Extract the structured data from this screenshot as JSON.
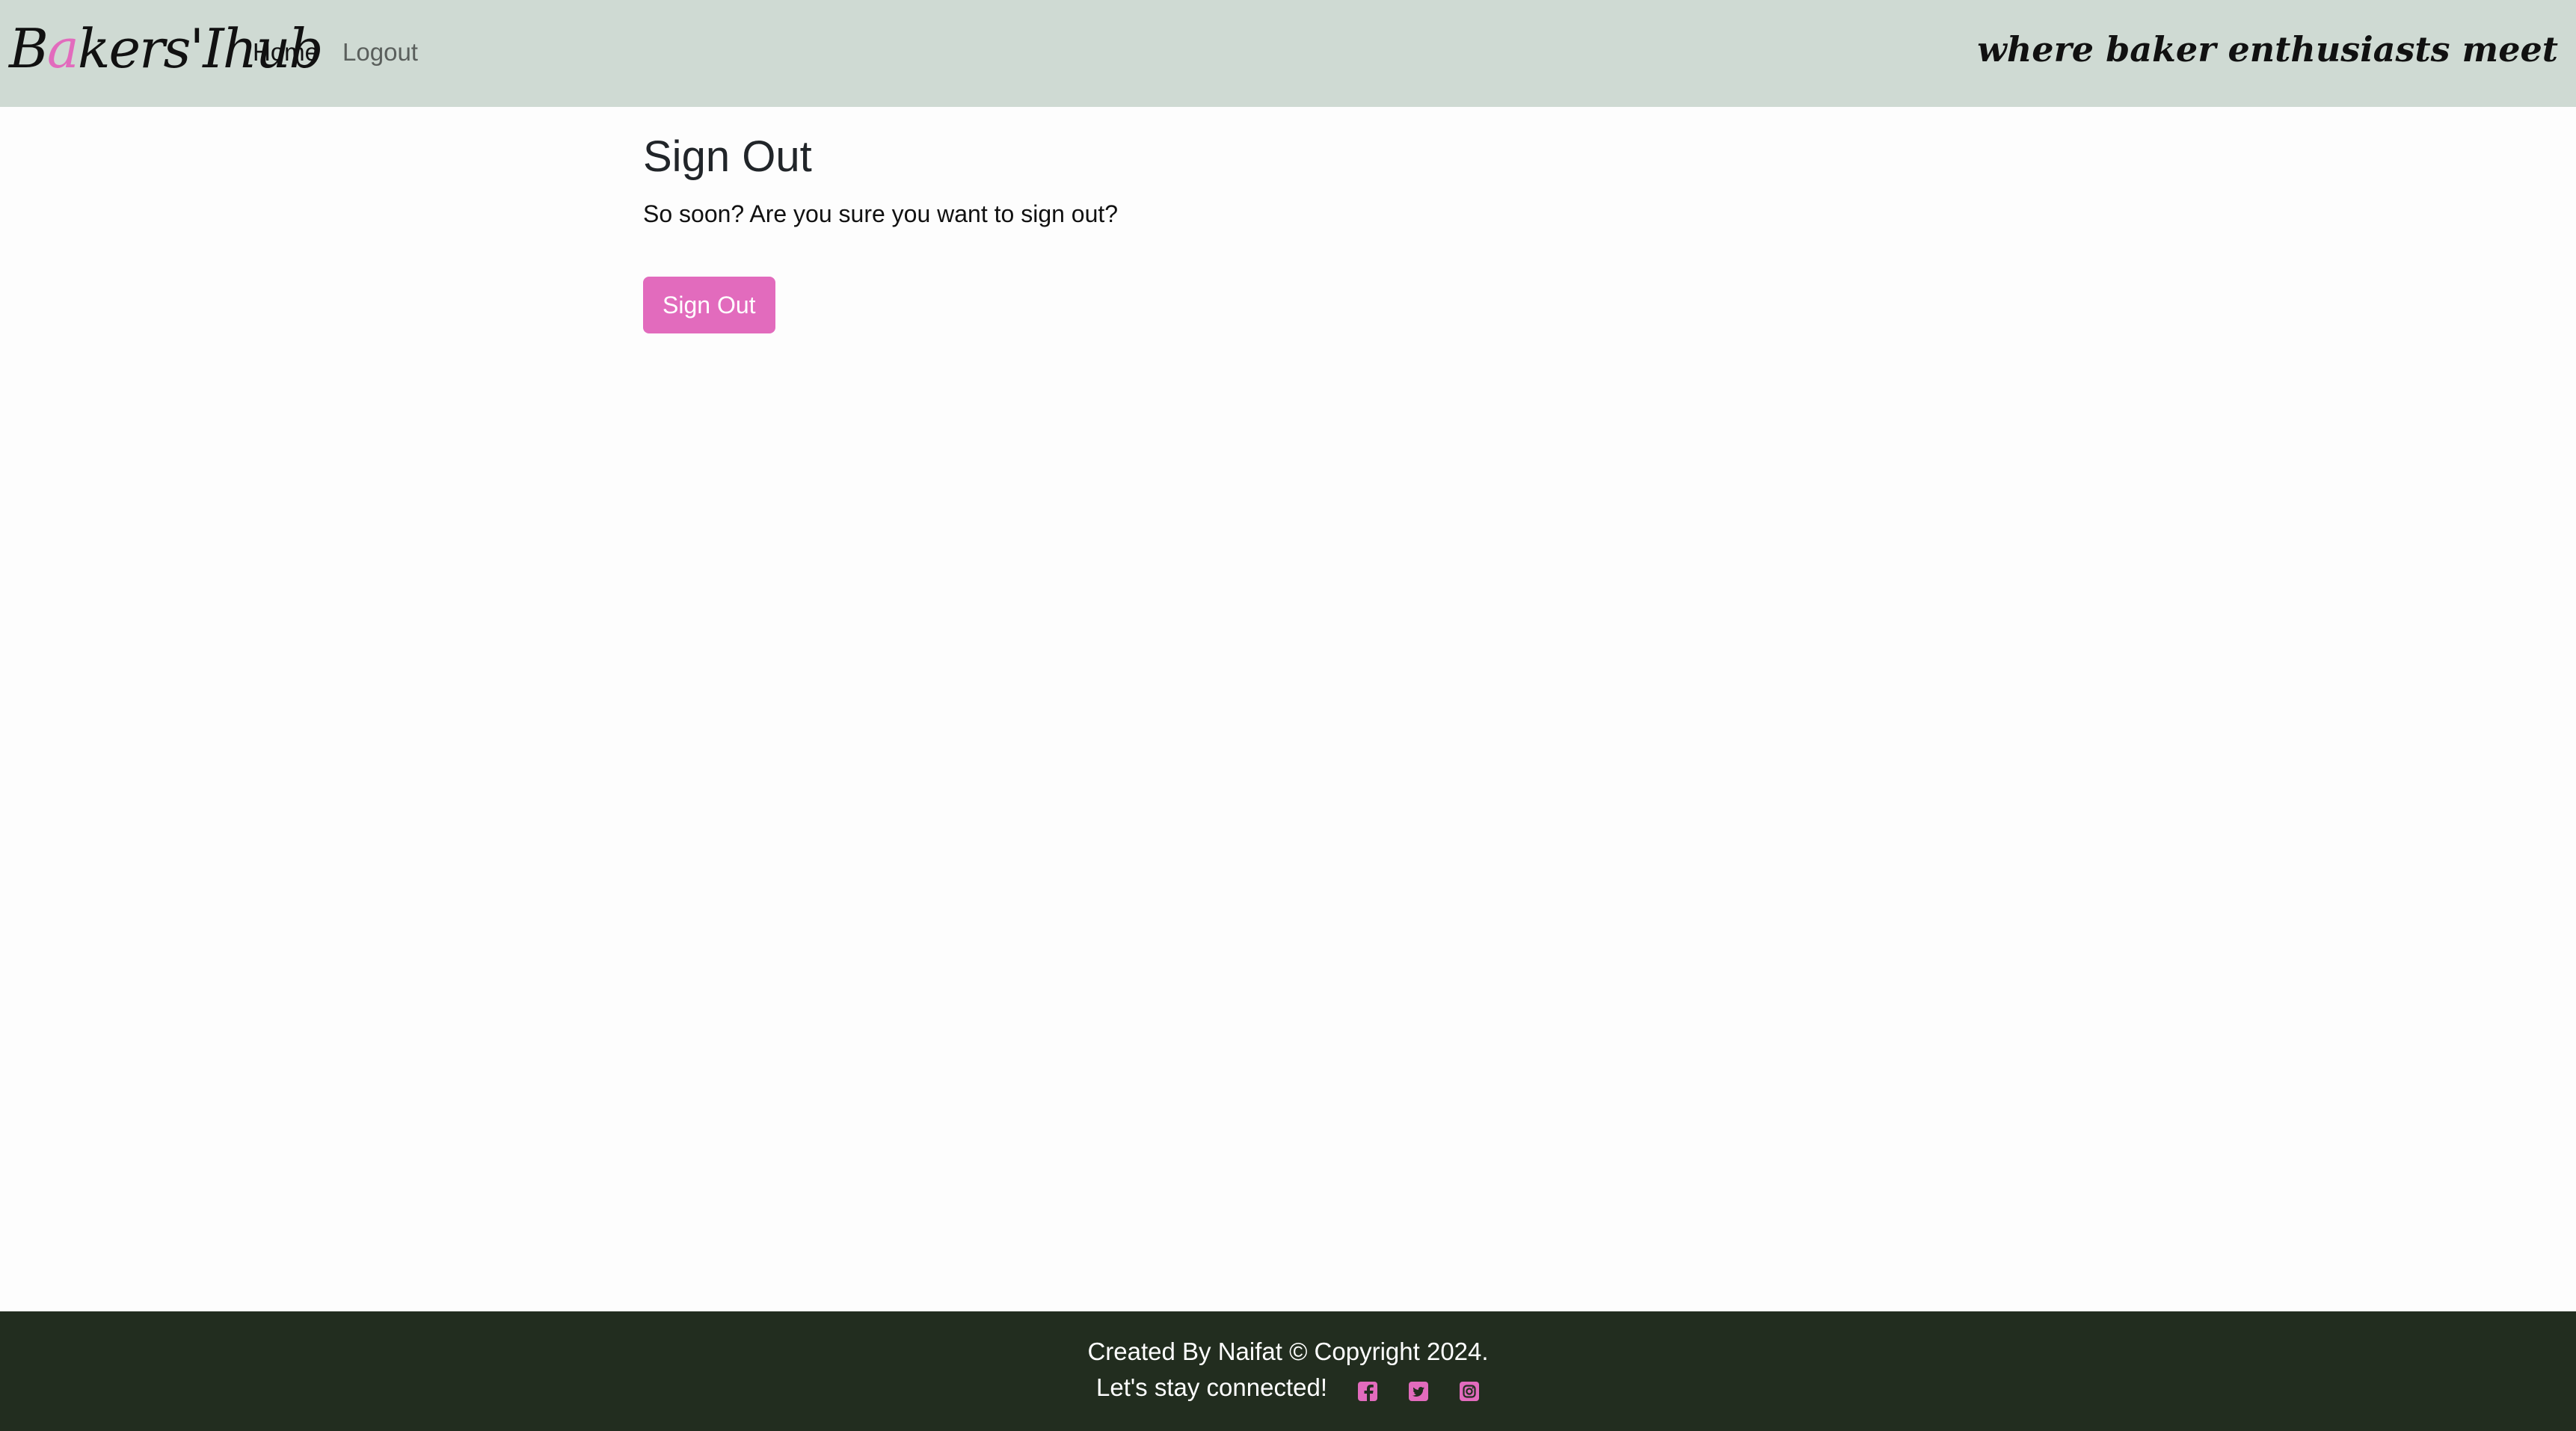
{
  "navbar": {
    "brand_first": "B",
    "brand_accent": "a",
    "brand_rest": "kers'Ihub",
    "links": [
      {
        "label": "Home"
      },
      {
        "label": "Logout"
      }
    ],
    "tagline": "where baker enthusiasts meet"
  },
  "main": {
    "title": "Sign Out",
    "text": "So soon? Are you sure you want to sign out?",
    "button_label": "Sign Out"
  },
  "footer": {
    "credit": "Created By Naifat © Copyright 2024.",
    "connect": "Let's stay connected!",
    "icons": [
      "facebook-icon",
      "twitter-icon",
      "instagram-icon"
    ]
  },
  "colors": {
    "accent": "#e26bbd",
    "navbar_bg": "#cfdad3",
    "footer_bg": "#222d1f"
  }
}
